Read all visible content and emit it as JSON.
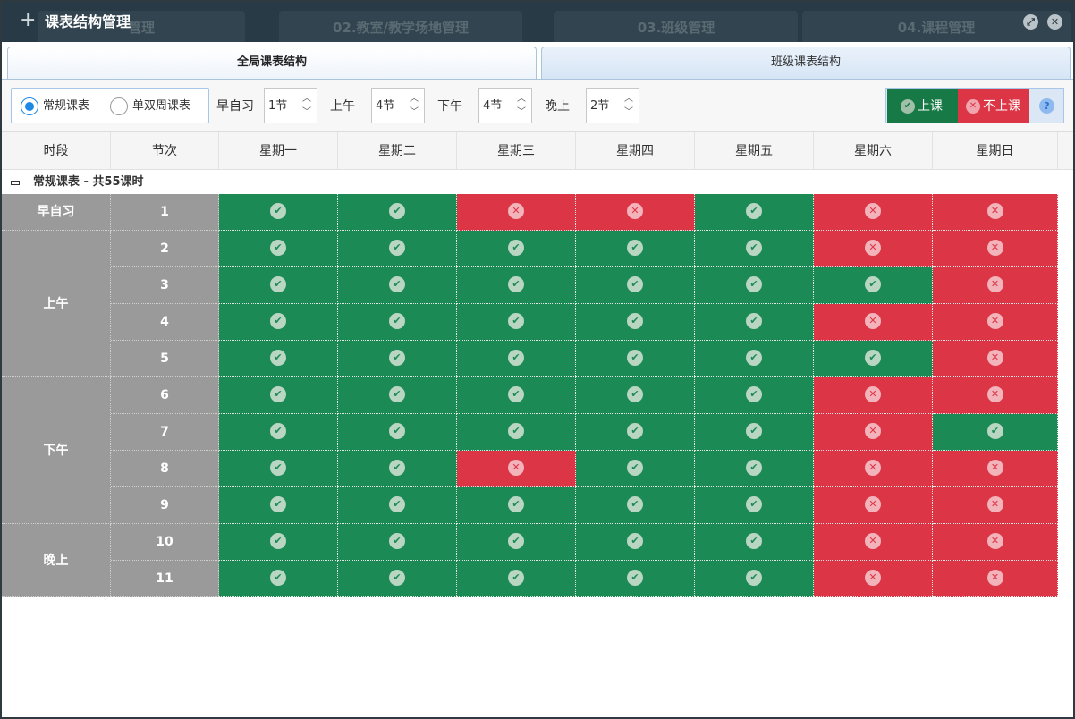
{
  "window": {
    "title": "课表结构管理",
    "background_tabs": [
      "管理",
      "02.教室/教学场地管理",
      "03.班级管理",
      "04.课程管理"
    ]
  },
  "tabs": [
    {
      "label": "全局课表结构",
      "active": true
    },
    {
      "label": "班级课表结构",
      "active": false
    }
  ],
  "toolbar": {
    "radios": [
      {
        "label": "常规课表",
        "checked": true
      },
      {
        "label": "单双周课表",
        "checked": false
      }
    ],
    "spinners": [
      {
        "label": "早自习",
        "value": "1节"
      },
      {
        "label": "上午",
        "value": "4节"
      },
      {
        "label": "下午",
        "value": "4节"
      },
      {
        "label": "晚上",
        "value": "2节"
      }
    ],
    "legend": {
      "on_label": "上课",
      "off_label": "不上课",
      "help": "?"
    }
  },
  "table": {
    "headers": [
      "时段",
      "节次",
      "星期一",
      "星期二",
      "星期三",
      "星期四",
      "星期五",
      "星期六",
      "星期日"
    ],
    "group_title": "常规课表 - 共55课时",
    "periods": [
      {
        "label": "早自习",
        "span": 1
      },
      {
        "label": "上午",
        "span": 4
      },
      {
        "label": "下午",
        "span": 4
      },
      {
        "label": "晚上",
        "span": 2
      }
    ],
    "rows": [
      {
        "session": "1",
        "cells": [
          1,
          1,
          0,
          0,
          1,
          0,
          0
        ]
      },
      {
        "session": "2",
        "cells": [
          1,
          1,
          1,
          1,
          1,
          0,
          0
        ]
      },
      {
        "session": "3",
        "cells": [
          1,
          1,
          1,
          1,
          1,
          1,
          0
        ]
      },
      {
        "session": "4",
        "cells": [
          1,
          1,
          1,
          1,
          1,
          0,
          0
        ]
      },
      {
        "session": "5",
        "cells": [
          1,
          1,
          1,
          1,
          1,
          1,
          0
        ]
      },
      {
        "session": "6",
        "cells": [
          1,
          1,
          1,
          1,
          1,
          0,
          0
        ]
      },
      {
        "session": "7",
        "cells": [
          1,
          1,
          1,
          1,
          1,
          0,
          1
        ]
      },
      {
        "session": "8",
        "cells": [
          1,
          1,
          0,
          1,
          1,
          0,
          0
        ]
      },
      {
        "session": "9",
        "cells": [
          1,
          1,
          1,
          1,
          1,
          0,
          0
        ]
      },
      {
        "session": "10",
        "cells": [
          1,
          1,
          1,
          1,
          1,
          0,
          0
        ]
      },
      {
        "session": "11",
        "cells": [
          1,
          1,
          1,
          1,
          1,
          0,
          0
        ]
      }
    ]
  },
  "colors": {
    "on": "#1b8a55",
    "off": "#dc3545",
    "period_bg": "#9a9a9a"
  }
}
